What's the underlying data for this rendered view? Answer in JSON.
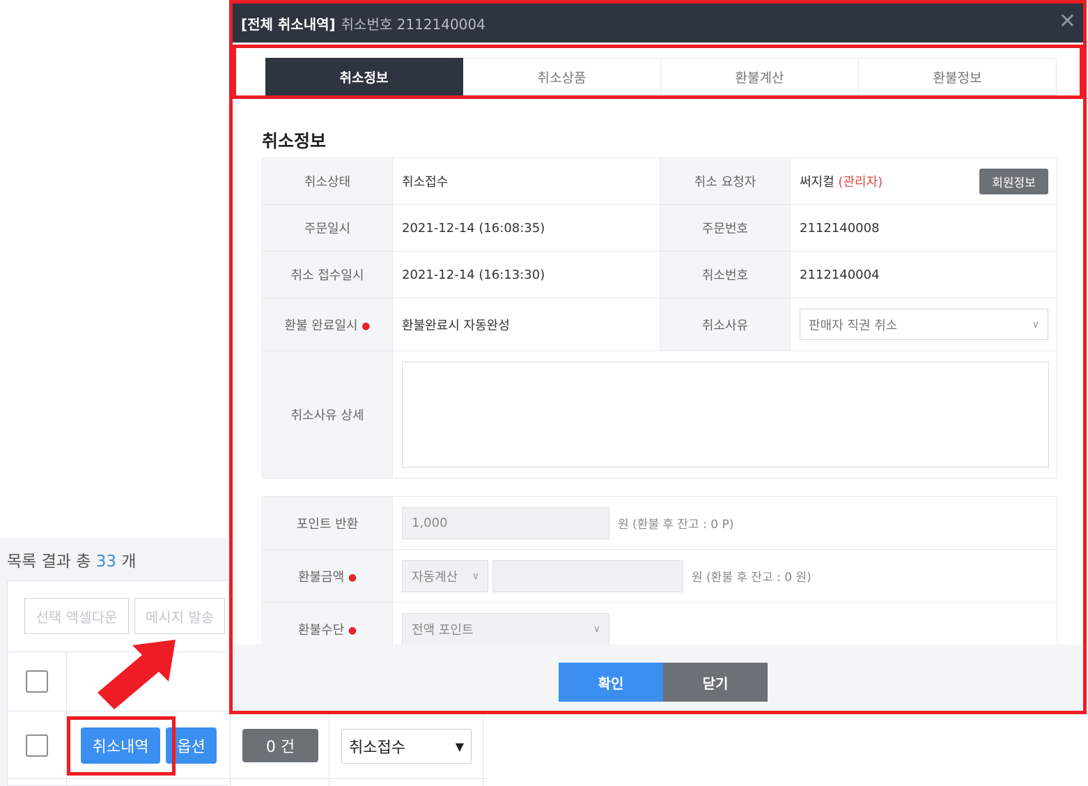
{
  "background": {
    "result_prefix": "목록 결과 총",
    "result_count": "33",
    "result_suffix": "개",
    "excel_button": "선택 액셀다운",
    "message_button": "메시지 발송",
    "cancel_history_button": "취소내역",
    "option_button": "옵션",
    "count_badge": "0 건",
    "status_select": "취소접수"
  },
  "modal": {
    "title": "[전체 취소내역]",
    "subtitle": "취소번호 2112140004",
    "close_glyph": "✕",
    "tabs": [
      {
        "label": "취소정보"
      },
      {
        "label": "취소상품"
      },
      {
        "label": "환불계산"
      },
      {
        "label": "환불정보"
      }
    ],
    "section_title": "취소정보",
    "fields": {
      "cancel_status_label": "취소상태",
      "cancel_status_value": "취소접수",
      "requester_label": "취소 요청자",
      "requester_value": "써지컬",
      "requester_role": "(관리자)",
      "member_info_button": "회원정보",
      "order_date_label": "주문일시",
      "order_date_value": "2021-12-14 (16:08:35)",
      "order_no_label": "주문번호",
      "order_no_value": "2112140008",
      "cancel_date_label": "취소 접수일시",
      "cancel_date_value": "2021-12-14 (16:13:30)",
      "cancel_no_label": "취소번호",
      "cancel_no_value": "2112140004",
      "refund_done_label": "환불 완료일시",
      "refund_done_value": "환불완료시 자동완성",
      "reason_label": "취소사유",
      "reason_value": "판매자 직권 취소",
      "reason_detail_label": "취소사유 상세",
      "reason_detail_value": ""
    },
    "refund": {
      "point_label": "포인트 반환",
      "point_value": "1,000",
      "point_note": "원 (환불 후 잔고 : 0 P)",
      "amount_label": "환불금액",
      "amount_mode": "자동계산",
      "amount_value": "",
      "amount_note": "원 (환불 후 잔고 : 0 원)",
      "method_label": "환불수단",
      "method_value": "전액 포인트"
    },
    "confirm_button": "확인",
    "close_button": "닫기"
  }
}
